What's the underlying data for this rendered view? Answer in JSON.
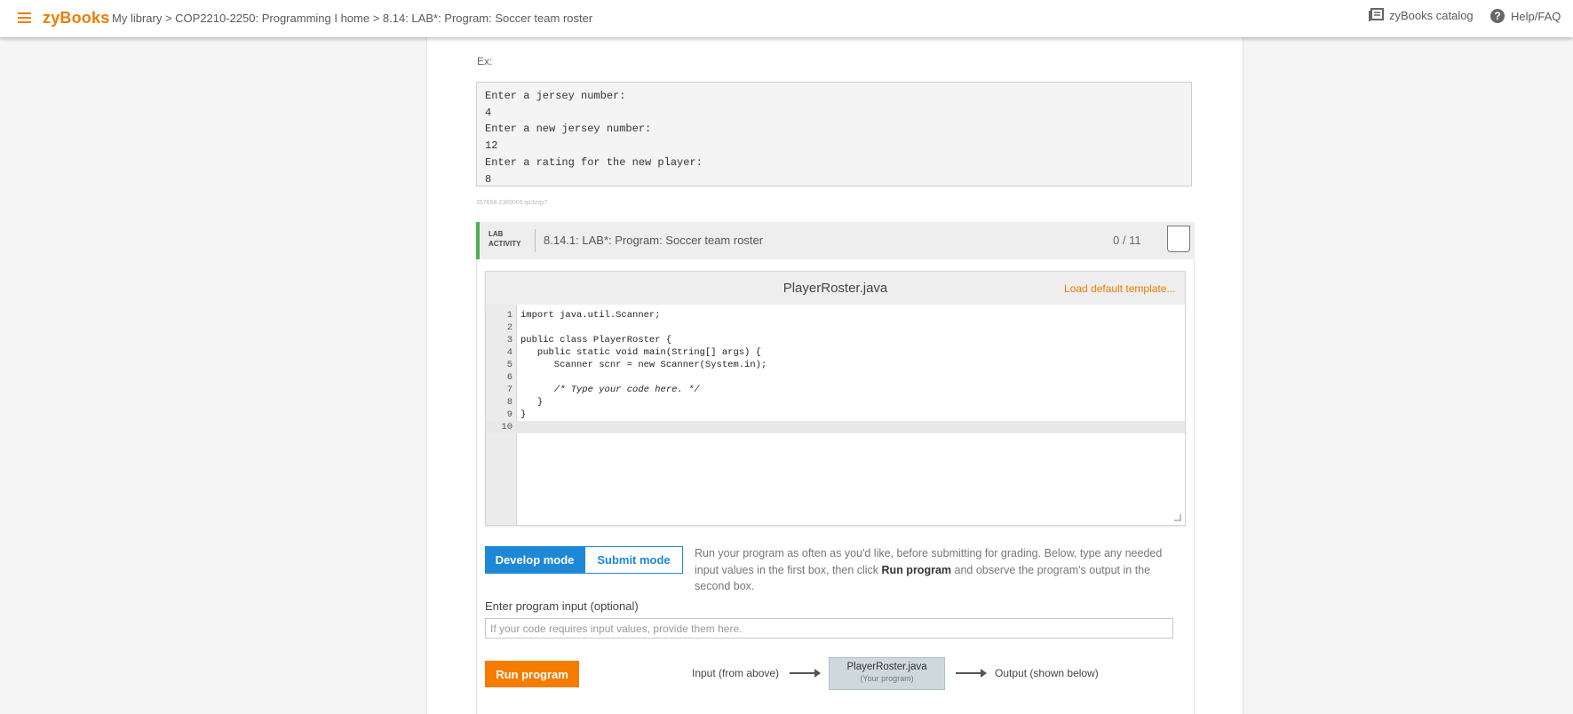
{
  "topbar": {
    "brand": "zyBooks",
    "breadcrumb": "My library > COP2210-2250: Programming I home > 8.14: LAB*: Program: Soccer team roster",
    "catalog_label": "zyBooks catalog",
    "help_label": "Help/FAQ",
    "icons": [
      "menu-icon",
      "catalog-icon",
      "help-icon"
    ]
  },
  "example": {
    "label": "Ex:",
    "lines": [
      "Enter a jersey number:",
      "4",
      "Enter a new jersey number:",
      "12",
      "Enter a rating for the new player:",
      "8"
    ],
    "id_text": "357658.2389009.qx3zqy7"
  },
  "lab": {
    "tag_line1": "LAB",
    "tag_line2": "ACTIVITY",
    "title": "8.14.1: LAB*: Program: Soccer team roster",
    "score": "0 / 11",
    "accent_color": "#4caf50"
  },
  "editor": {
    "filename": "PlayerRoster.java",
    "load_default": "Load default template...",
    "lines": [
      {
        "num": "1",
        "text": "import java.util.Scanner;"
      },
      {
        "num": "2",
        "text": ""
      },
      {
        "num": "3",
        "text": "public class PlayerRoster {"
      },
      {
        "num": "4",
        "text": "   public static void main(String[] args) {"
      },
      {
        "num": "5",
        "text": "      Scanner scnr = new Scanner(System.in);"
      },
      {
        "num": "6",
        "text": ""
      },
      {
        "num": "7",
        "text": "      /* Type your code here. */"
      },
      {
        "num": "8",
        "text": "   }"
      },
      {
        "num": "9",
        "text": "}"
      },
      {
        "num": "10",
        "text": ""
      }
    ]
  },
  "modes": {
    "develop": "Develop mode",
    "submit": "Submit mode",
    "desc_part1": "Run your program as often as you'd like, before submitting for grading. Below, type any needed input values in the first box, then click ",
    "desc_bold": "Run program",
    "desc_part2": " and observe the program's output in the second box."
  },
  "input": {
    "label": "Enter program input (optional)",
    "placeholder": "If your code requires input values, provide them here.",
    "value": ""
  },
  "run": {
    "button": "Run program",
    "flow_input": "Input (from above)",
    "flow_prog_name": "PlayerRoster.java",
    "flow_prog_sub": "(Your program)",
    "flow_output": "Output (shown below)"
  },
  "colors": {
    "brand": "#f07c00",
    "develop_blue": "#1e88d6",
    "run_orange": "#f57c00"
  }
}
